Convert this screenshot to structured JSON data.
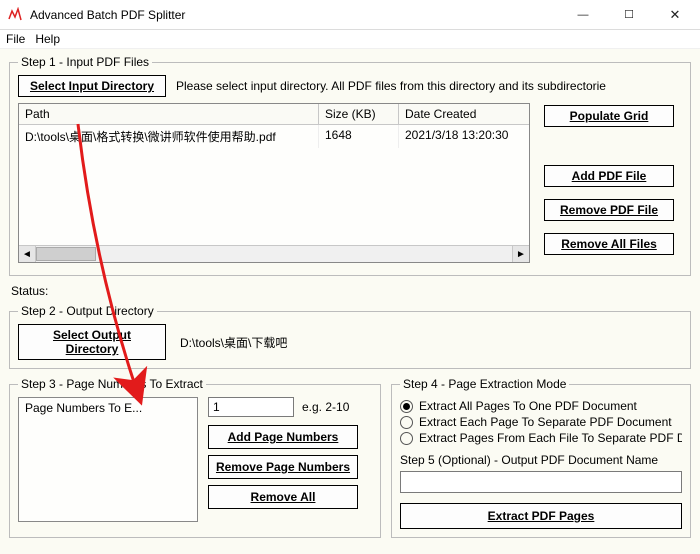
{
  "window": {
    "title": "Advanced Batch PDF Splitter",
    "min_icon": "—",
    "max_icon": "☐",
    "close_icon": "✕"
  },
  "menu": {
    "file": "File",
    "help": "Help"
  },
  "step1": {
    "legend": "Step 1 - Input PDF Files",
    "select_btn": "Select Input Directory",
    "hint": "Please select input directory. All PDF files from this directory and its subdirectorie",
    "cols": {
      "path": "Path",
      "size": "Size (KB)",
      "date": "Date Created"
    },
    "rows": [
      {
        "path": "D:\\tools\\桌面\\格式转换\\微讲师软件使用帮助.pdf",
        "size": "1648",
        "date": "2021/3/18 13:20:30"
      }
    ],
    "btn_populate": "Populate Grid",
    "btn_add": "Add PDF File",
    "btn_remove": "Remove PDF File",
    "btn_remove_all": "Remove All Files"
  },
  "status": {
    "label": "Status:"
  },
  "step2": {
    "legend": "Step 2 - Output Directory",
    "select_btn": "Select Output Directory",
    "path": "D:\\tools\\桌面\\下载吧"
  },
  "step3": {
    "legend": "Step 3 - Page Numbers To Extract",
    "list_header": "Page Numbers To E...",
    "input_value": "1",
    "example": "e.g. 2-10",
    "btn_add": "Add Page Numbers",
    "btn_remove": "Remove Page Numbers",
    "btn_remove_all": "Remove All"
  },
  "step4": {
    "legend": "Step 4 - Page Extraction Mode",
    "opt1": "Extract All Pages To One PDF Document",
    "opt2": "Extract Each Page To Separate PDF Document",
    "opt3": "Extract Pages From Each File To Separate PDF Docu",
    "step5_label": "Step 5 (Optional) - Output PDF Document Name",
    "extract_btn": "Extract PDF Pages"
  }
}
